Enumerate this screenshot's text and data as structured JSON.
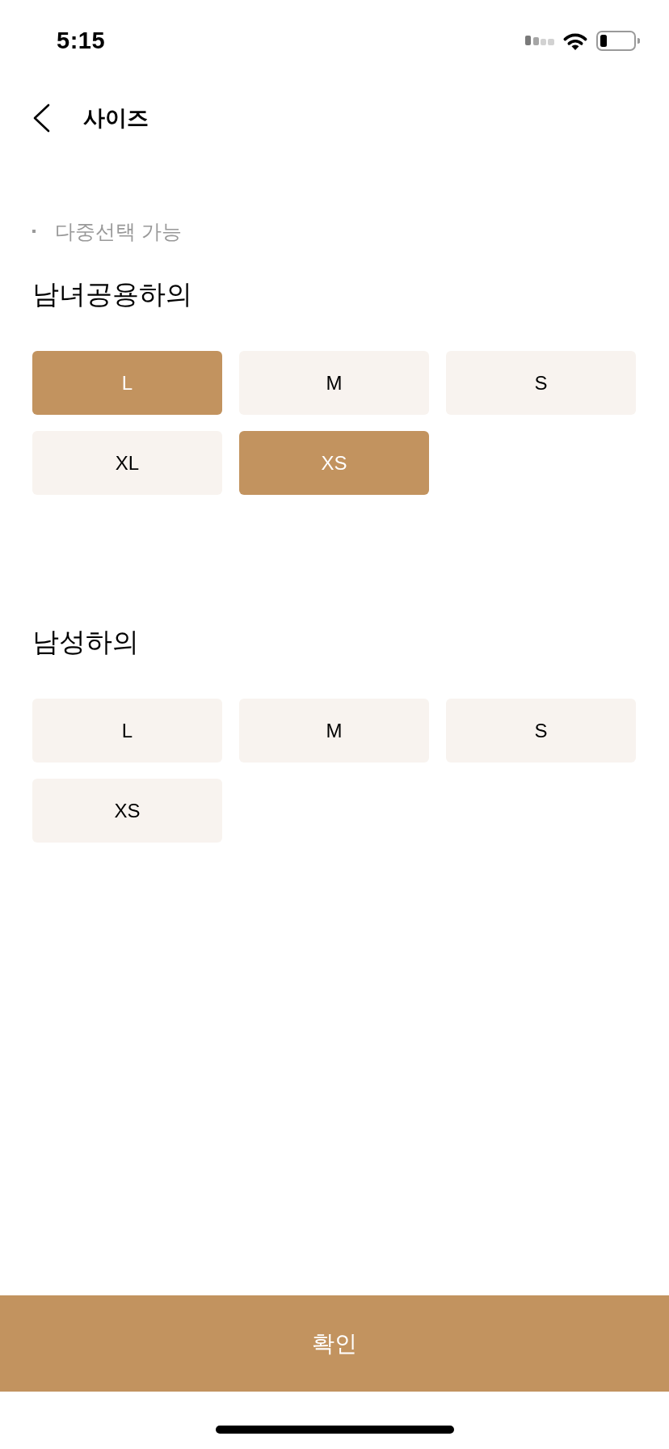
{
  "status_bar": {
    "time": "5:15"
  },
  "header": {
    "title": "사이즈"
  },
  "note": "다중선택 가능",
  "sections": [
    {
      "title": "남녀공용하의",
      "options": [
        {
          "label": "L",
          "selected": true
        },
        {
          "label": "M",
          "selected": false
        },
        {
          "label": "S",
          "selected": false
        },
        {
          "label": "XL",
          "selected": false
        },
        {
          "label": "XS",
          "selected": true
        }
      ]
    },
    {
      "title": "남성하의",
      "options": [
        {
          "label": "L",
          "selected": false
        },
        {
          "label": "M",
          "selected": false
        },
        {
          "label": "S",
          "selected": false
        },
        {
          "label": "XS",
          "selected": false
        }
      ]
    }
  ],
  "confirm_button": "확인"
}
